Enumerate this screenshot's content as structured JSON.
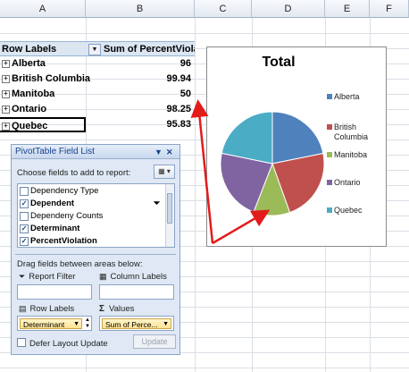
{
  "columns": [
    "A",
    "B",
    "C",
    "D",
    "E",
    "F"
  ],
  "pivot": {
    "header_row_labels": "Row Labels",
    "header_sum": "Sum of PercentViolation",
    "rows": [
      {
        "label": "Alberta",
        "value": "96"
      },
      {
        "label": "British Columbia",
        "value": "99.94"
      },
      {
        "label": "Manitoba",
        "value": "50"
      },
      {
        "label": "Ontario",
        "value": "98.25"
      },
      {
        "label": "Quebec",
        "value": "95.83"
      }
    ]
  },
  "chart": {
    "title": "Total",
    "legend": [
      {
        "label": "Alberta",
        "color": "#4f81bd"
      },
      {
        "label": "British\nColumbia",
        "color": "#c0504d"
      },
      {
        "label": "Manitoba",
        "color": "#9bbb59"
      },
      {
        "label": "Ontario",
        "color": "#8064a2"
      },
      {
        "label": "Quebec",
        "color": "#4bacc6"
      }
    ]
  },
  "chart_data": {
    "type": "pie",
    "title": "Total",
    "categories": [
      "Alberta",
      "British Columbia",
      "Manitoba",
      "Ontario",
      "Quebec"
    ],
    "values": [
      96,
      99.94,
      50,
      98.25,
      95.83
    ],
    "colors": [
      "#4f81bd",
      "#c0504d",
      "#9bbb59",
      "#8064a2",
      "#4bacc6"
    ],
    "legend_position": "right"
  },
  "field_list": {
    "title": "PivotTable Field List",
    "choose_label": "Choose fields to add to report:",
    "fields": [
      {
        "label": "Dependency Type",
        "checked": false,
        "bold": false
      },
      {
        "label": "Dependent",
        "checked": true,
        "bold": true
      },
      {
        "label": "Dependeny Counts",
        "checked": false,
        "bold": false
      },
      {
        "label": "Determinant",
        "checked": true,
        "bold": true
      },
      {
        "label": "PercentViolation",
        "checked": true,
        "bold": true
      }
    ],
    "drag_label": "Drag fields between areas below:",
    "report_filter": "Report Filter",
    "column_labels": "Column Labels",
    "row_labels": "Row Labels",
    "values": "Values",
    "row_pill": "Determinant",
    "values_pill": "Sum of Perce...",
    "defer_label": "Defer Layout Update",
    "update_label": "Update"
  }
}
